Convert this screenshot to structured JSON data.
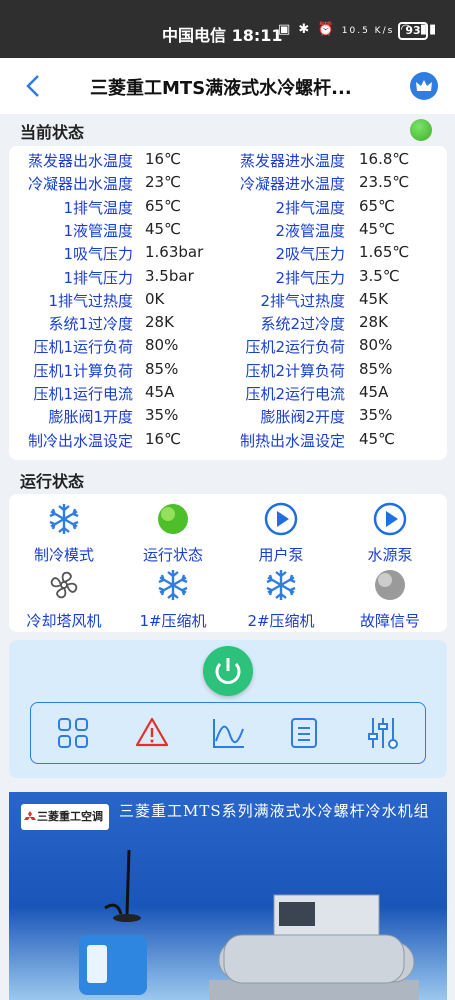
{
  "status_bar": {
    "carrier": "中国电信",
    "time": "18:11",
    "network_speed": "10.5 K/s",
    "battery": "93"
  },
  "header": {
    "title": "三菱重工MTS满液式水冷螺杆...",
    "back_icon": "chevron-left-icon",
    "vip_icon": "crown-icon"
  },
  "current_status": {
    "section_title": "当前状态",
    "indicator_color": "#4cc23a",
    "params": [
      {
        "label": "蒸发器出水温度",
        "value": "16℃",
        "label2": "蒸发器进水温度",
        "value2": "16.8℃"
      },
      {
        "label": "冷凝器出水温度",
        "value": "23℃",
        "label2": "冷凝器进水温度",
        "value2": "23.5℃"
      },
      {
        "label": "1排气温度",
        "value": "65℃",
        "label2": "2排气温度",
        "value2": "65℃"
      },
      {
        "label": "1液管温度",
        "value": "45℃",
        "label2": "2液管温度",
        "value2": "45℃"
      },
      {
        "label": "1吸气压力",
        "value": "1.63bar",
        "label2": "2吸气压力",
        "value2": "1.65℃"
      },
      {
        "label": "1排气压力",
        "value": "3.5bar",
        "label2": "2排气压力",
        "value2": "3.5℃"
      },
      {
        "label": "1排气过热度",
        "value": "0K",
        "label2": "2排气过热度",
        "value2": "45K"
      },
      {
        "label": "系统1过冷度",
        "value": "28K",
        "label2": "系统2过冷度",
        "value2": "28K"
      },
      {
        "label": "压机1运行负荷",
        "value": "80%",
        "label2": "压机2运行负荷",
        "value2": "80%"
      },
      {
        "label": "压机1计算负荷",
        "value": "85%",
        "label2": "压机2计算负荷",
        "value2": "85%"
      },
      {
        "label": "压机1运行电流",
        "value": "45A",
        "label2": "压机2运行电流",
        "value2": "45A"
      },
      {
        "label": "膨胀阀1开度",
        "value": "35%",
        "label2": "膨胀阀2开度",
        "value2": "35%"
      },
      {
        "label": "制冷出水温设定",
        "value": "16℃",
        "label2": "制热出水温设定",
        "value2": "45℃"
      }
    ]
  },
  "run_status": {
    "section_title": "运行状态",
    "items": [
      {
        "label": "制冷模式",
        "icon": "snowflake-icon"
      },
      {
        "label": "运行状态",
        "icon": "green-light-icon"
      },
      {
        "label": "用户泵",
        "icon": "play-icon"
      },
      {
        "label": "水源泵",
        "icon": "play-icon"
      },
      {
        "label": "冷却塔风机",
        "icon": "fan-icon"
      },
      {
        "label": "1#压缩机",
        "icon": "snowflake-icon"
      },
      {
        "label": "2#压缩机",
        "icon": "snowflake-icon"
      },
      {
        "label": "故障信号",
        "icon": "gray-light-icon"
      }
    ]
  },
  "controls": {
    "power_icon": "power-icon",
    "toolbar": [
      "grid-icon",
      "warning-icon",
      "chart-icon",
      "list-icon",
      "sliders-icon"
    ]
  },
  "banner": {
    "logo_text": "三菱重工空调",
    "headline": "三菱重工MTS系列满液式水冷螺杆冷水机组"
  }
}
